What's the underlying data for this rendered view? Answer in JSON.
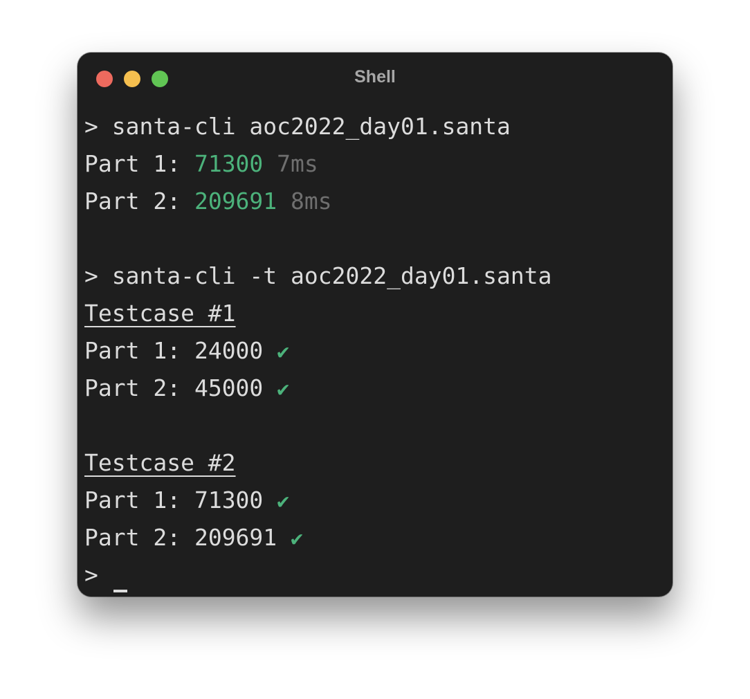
{
  "window": {
    "title": "Shell",
    "colors": {
      "background": "#1e1e1e",
      "text": "#dcdcdc",
      "success": "#4cb27b",
      "muted": "#6f6f6f",
      "traffic_red": "#ed6a5e",
      "traffic_yellow": "#f5bf4f",
      "traffic_green": "#61c554"
    }
  },
  "terminal": {
    "prompt_symbol": ">",
    "check_glyph": "✔",
    "run": {
      "command": "santa-cli aoc2022_day01.santa",
      "results": [
        {
          "label": "Part 1:",
          "value": "71300",
          "time": "7ms"
        },
        {
          "label": "Part 2:",
          "value": "209691",
          "time": "8ms"
        }
      ]
    },
    "test": {
      "command": "santa-cli -t aoc2022_day01.santa",
      "testcases": [
        {
          "title": "Testcase #1",
          "results": [
            {
              "label": "Part 1:",
              "value": "24000"
            },
            {
              "label": "Part 2:",
              "value": "45000"
            }
          ]
        },
        {
          "title": "Testcase #2",
          "results": [
            {
              "label": "Part 1:",
              "value": "71300"
            },
            {
              "label": "Part 2:",
              "value": "209691"
            }
          ]
        }
      ]
    }
  }
}
